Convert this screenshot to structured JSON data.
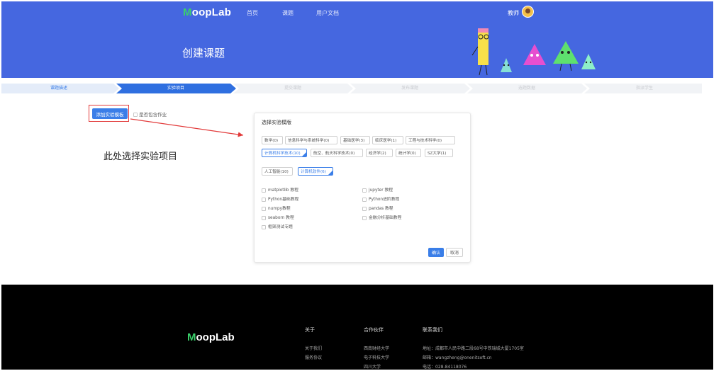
{
  "brand": {
    "logo_first": "M",
    "logo_rest": "oopLab"
  },
  "nav": {
    "items": [
      "首页",
      "课题",
      "用户文档"
    ],
    "user_name": "教师"
  },
  "banner": {
    "title": "创建课题"
  },
  "steps": [
    {
      "label": "课题描述",
      "state": "done"
    },
    {
      "label": "实验项目",
      "state": "active"
    },
    {
      "label": "提交课题",
      "state": "pending"
    },
    {
      "label": "发布课题",
      "state": "pending"
    },
    {
      "label": "选题数据",
      "state": "pending"
    },
    {
      "label": "指派学生",
      "state": "pending"
    }
  ],
  "content": {
    "add_button": "添加实验模板",
    "homework_label": "是否包含作业",
    "annotation": "此处选择实验项目"
  },
  "dialog": {
    "title": "选择实验模版",
    "category_tags": [
      {
        "label": "数学(0)",
        "selected": false
      },
      {
        "label": "信息科学与系统科学(0)",
        "selected": false
      },
      {
        "label": "基础医学(3)",
        "selected": false
      },
      {
        "label": "临床医学(1)",
        "selected": false
      },
      {
        "label": "工程与技术科学(0)",
        "selected": false
      },
      {
        "label": "计算机科学技术(10)",
        "selected": true
      },
      {
        "label": "航空、航天科学技术(0)",
        "selected": false
      },
      {
        "label": "经济学(2)",
        "selected": false
      },
      {
        "label": "统计学(0)",
        "selected": false
      },
      {
        "label": "SZ大学(1)",
        "selected": false
      }
    ],
    "sub_tags": [
      {
        "label": "人工智能(10)",
        "selected": false
      },
      {
        "label": "计算机软件(6)",
        "selected": true
      }
    ],
    "options": [
      "matplotlib 教程",
      "jupyter 教程",
      "Python基础教程",
      "Python进阶教程",
      "numpy教程",
      "pandas 教程",
      "seaborn 教程",
      "金融分析基础教程",
      "框架测试专题"
    ],
    "ok_button": "确认",
    "cancel_button": "取消"
  },
  "footer": {
    "about_heading": "关于",
    "about_links": [
      "关于我们",
      "服务协议"
    ],
    "partners_heading": "合作伙伴",
    "partners": [
      "西南财经大学",
      "电子科技大学",
      "四川大学"
    ],
    "contact_heading": "联系我们",
    "address": "地址：成都市人民中路二段68号中铁瑞城大厦1705室",
    "email": "邮箱：wangzheng@onenitsoft.cn",
    "phone": "电话：028-84118076"
  },
  "colors": {
    "primary": "#4567e0",
    "accent_button": "#3a7ee8",
    "annotation_red": "#e23a3a",
    "footer_bg": "#000000"
  }
}
